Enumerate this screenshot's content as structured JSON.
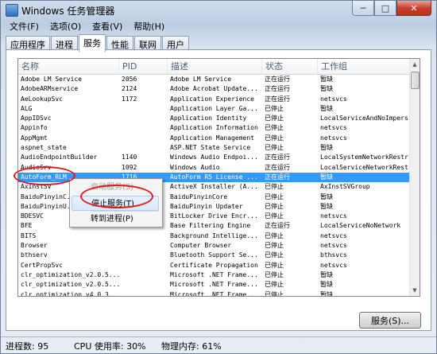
{
  "window": {
    "title": "Windows 任务管理器"
  },
  "menubar": [
    "文件(F)",
    "选项(O)",
    "查看(V)",
    "帮助(H)"
  ],
  "tabs": [
    "应用程序",
    "进程",
    "服务",
    "性能",
    "联网",
    "用户"
  ],
  "active_tab": "服务",
  "columns": [
    "名称",
    "PID",
    "描述",
    "状态",
    "工作组"
  ],
  "rows": [
    [
      "Adobe LM Service",
      "2056",
      "Adobe LM Service",
      "正在运行",
      "暂缺"
    ],
    [
      "AdobeARMservice",
      "2124",
      "Adobe Acrobat Update...",
      "正在运行",
      "暂缺"
    ],
    [
      "AeLookupSvc",
      "1172",
      "Application Experience",
      "正在运行",
      "netsvcs"
    ],
    [
      "ALG",
      "",
      "Application Layer Ga...",
      "已停止",
      "暂缺"
    ],
    [
      "AppIDSvc",
      "",
      "Application Identity",
      "已停止",
      "LocalServiceAndNoImpers"
    ],
    [
      "Appinfo",
      "",
      "Application Information",
      "已停止",
      "netsvcs"
    ],
    [
      "AppMgmt",
      "",
      "Application Management",
      "已停止",
      "netsvcs"
    ],
    [
      "aspnet_state",
      "",
      "ASP.NET State Service",
      "已停止",
      "暂缺"
    ],
    [
      "AudioEndpointBuilder",
      "1140",
      "Windows Audio Endpoi...",
      "正在运行",
      "LocalSystemNetworkRestr"
    ],
    [
      "AudioSrv",
      "1092",
      "Windows Audio",
      "正在运行",
      "LocalServiceNetworkRestr"
    ],
    [
      "AutoForm_RLM",
      "1716",
      "AutoForm R5 License ...",
      "正在运行",
      "暂缺"
    ],
    [
      "AxInstSV",
      "",
      "ActiveX Installer (A...",
      "已停止",
      "AxInstSVGroup"
    ],
    [
      "BaiduPinyinC...",
      "",
      "BaiduPinyinCore",
      "已停止",
      "暂缺"
    ],
    [
      "BaiduPinyinU...",
      "",
      "BaiduPinyin Updater",
      "已停止",
      "暂缺"
    ],
    [
      "BDESVC",
      "",
      "BitLocker Drive Encr...",
      "已停止",
      "netsvcs"
    ],
    [
      "BFE",
      "1820",
      "Base Filtering Engine",
      "正在运行",
      "LocalServiceNoNetwork"
    ],
    [
      "BITS",
      "",
      "Background Intellige...",
      "已停止",
      "netsvcs"
    ],
    [
      "Browser",
      "",
      "Computer Browser",
      "已停止",
      "netsvcs"
    ],
    [
      "bthserv",
      "",
      "Bluetooth Support Se...",
      "已停止",
      "bthsvcs"
    ],
    [
      "CertPropSvc",
      "",
      "Certificate Propagation",
      "已停止",
      "netsvcs"
    ],
    [
      "clr_optimization_v2.0.5...",
      "",
      "Microsoft .NET Frame...",
      "已停止",
      "暂缺"
    ],
    [
      "clr_optimization_v2.0.5...",
      "",
      "Microsoft .NET Frame...",
      "已停止",
      "暂缺"
    ],
    [
      "clr_optimization_v4.0.3...",
      "",
      "Microsoft .NET Frame...",
      "已停止",
      "暂缺"
    ]
  ],
  "selected_row": 10,
  "context_menu": {
    "items": [
      "启动服务(S)",
      "停止服务(T)",
      "转到进程(P)"
    ],
    "disabled": [
      true,
      false,
      false
    ],
    "highlighted": 1
  },
  "services_button": "服务(S)...",
  "status": {
    "processes": "进程数: 95",
    "cpu": "CPU 使用率: 30%",
    "memory": "物理内存: 61%"
  },
  "colors": {
    "selection": "#3399ff",
    "annotation": "#e01818"
  }
}
